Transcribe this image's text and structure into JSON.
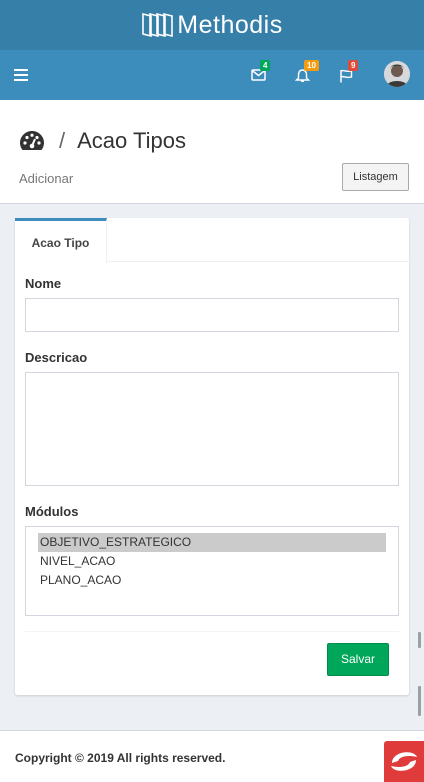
{
  "brand": {
    "name": "Methodis"
  },
  "navbar": {
    "messages_count": "4",
    "notifications_count": "10",
    "tasks_count": "9",
    "badge_colors": {
      "messages": "#00a65a",
      "notifications": "#f39c12",
      "tasks": "#dd4b39"
    }
  },
  "header": {
    "title": "Acao Tipos",
    "separator": "/",
    "subtitle": "Adicionar",
    "list_button": "Listagem"
  },
  "form": {
    "tab_label": "Acao Tipo",
    "nome_label": "Nome",
    "nome_value": "",
    "descricao_label": "Descricao",
    "descricao_value": "",
    "modulos_label": "Módulos",
    "modulos_options": [
      "OBJETIVO_ESTRATEGICO",
      "NIVEL_ACAO",
      "PLANO_ACAO"
    ],
    "modulos_selected": "OBJETIVO_ESTRATEGICO",
    "save_button": "Salvar"
  },
  "footer": {
    "copyright": "Copyright © 2019 All rights reserved."
  },
  "colors": {
    "brand_dark": "#367fa9",
    "navbar": "#3c8dbc",
    "success": "#00a65a",
    "footer_logo": "#e03b3b"
  }
}
